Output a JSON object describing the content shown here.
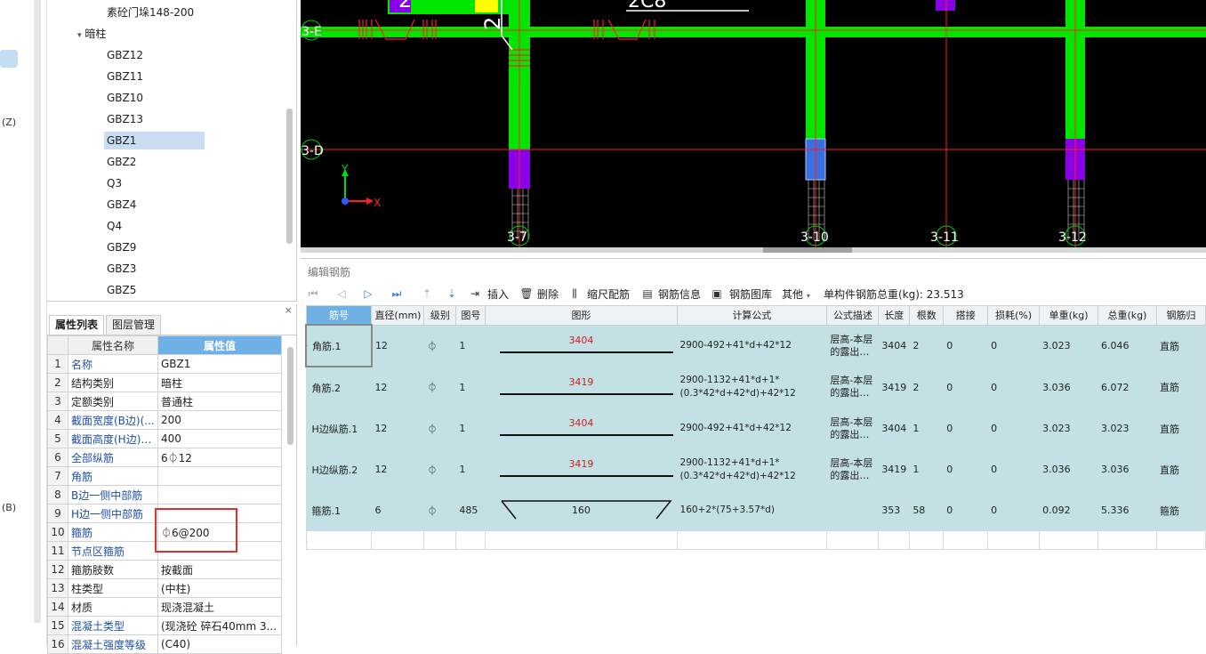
{
  "left_strip": {
    "label_z": "(Z)",
    "label_b": "(B)"
  },
  "tree": {
    "top_item": "素砼门垛148-200",
    "group": "暗柱",
    "items": [
      "GBZ12",
      "GBZ11",
      "GBZ10",
      "GBZ13",
      "GBZ1",
      "GBZ2",
      "Q3",
      "GBZ4",
      "Q4",
      "GBZ9",
      "GBZ3",
      "GBZ5"
    ],
    "selected": "GBZ1"
  },
  "props": {
    "tabs": [
      "属性列表",
      "图层管理"
    ],
    "close": "×",
    "header": {
      "name": "属性名称",
      "value": "属性值"
    },
    "rows": [
      {
        "n": "1",
        "k": "名称",
        "v": "GBZ1"
      },
      {
        "n": "2",
        "k": "结构类别",
        "v": "暗柱"
      },
      {
        "n": "3",
        "k": "定额类别",
        "v": "普通柱"
      },
      {
        "n": "4",
        "k": "截面宽度(B边)(...",
        "v": "200"
      },
      {
        "n": "5",
        "k": "截面高度(H边)(...",
        "v": "400"
      },
      {
        "n": "6",
        "k": "全部纵筋",
        "v": "6⏀12"
      },
      {
        "n": "7",
        "k": "角筋",
        "v": ""
      },
      {
        "n": "8",
        "k": "B边一侧中部筋",
        "v": ""
      },
      {
        "n": "9",
        "k": "H边一侧中部筋",
        "v": ""
      },
      {
        "n": "10",
        "k": "箍筋",
        "v": "⏀6@200"
      },
      {
        "n": "11",
        "k": "节点区箍筋",
        "v": ""
      },
      {
        "n": "12",
        "k": "箍筋肢数",
        "v": "按截面"
      },
      {
        "n": "13",
        "k": "柱类型",
        "v": "(中柱)"
      },
      {
        "n": "14",
        "k": "材质",
        "v": "现浇混凝土"
      },
      {
        "n": "15",
        "k": "混凝土类型",
        "v": "(现浇砼 碎石40mm 3..."
      },
      {
        "n": "16",
        "k": "混凝土强度等级",
        "v": "(C40)"
      }
    ]
  },
  "canvas": {
    "axis_y": "Y",
    "axis_x": "X",
    "labels": {
      "r1": "3-E",
      "r2": "3-D",
      "c1": "3-7",
      "c2": "3-10",
      "c3": "3-11",
      "c4": "3-12"
    },
    "colors": {
      "bg": "#000000",
      "wall": "#00e600",
      "column": "#8a00e6",
      "grid": "#ff0000",
      "blue_col": "#3a6fe0"
    }
  },
  "editor": {
    "title": "编辑钢筋",
    "toolbar": {
      "insert": "插入",
      "delete": "删除",
      "scale": "缩尺配筋",
      "info": "钢筋信息",
      "library": "钢筋图库",
      "other": "其他",
      "total": "单构件钢筋总重(kg): 23.513"
    },
    "columns": [
      "筋号",
      "直径(mm)",
      "级别",
      "图号",
      "图形",
      "计算公式",
      "公式描述",
      "长度",
      "根数",
      "搭接",
      "损耗(%)",
      "单重(kg)",
      "总重(kg)",
      "钢筋归"
    ],
    "rows": [
      {
        "idx": "1",
        "name": "角筋.1",
        "dia": "12",
        "grade": "⏀",
        "fig": "1",
        "shape": "3404",
        "formula": "2900-492+41*d+42*12",
        "desc": "层高-本层的露出…",
        "len": "3404",
        "count": "2",
        "lap": "0",
        "loss": "0",
        "unit": "3.023",
        "total": "6.046",
        "type": "直筋"
      },
      {
        "idx": "2",
        "name": "角筋.2",
        "dia": "12",
        "grade": "⏀",
        "fig": "1",
        "shape": "3419",
        "formula": "2900-1132+41*d+1*(0.3*42*d+42*d)+42*12",
        "desc": "层高-本层的露出…",
        "len": "3419",
        "count": "2",
        "lap": "0",
        "loss": "0",
        "unit": "3.036",
        "total": "6.072",
        "type": "直筋"
      },
      {
        "idx": "3",
        "name": "H边纵筋.1",
        "dia": "12",
        "grade": "⏀",
        "fig": "1",
        "shape": "3404",
        "formula": "2900-492+41*d+42*12",
        "desc": "层高-本层的露出…",
        "len": "3404",
        "count": "1",
        "lap": "0",
        "loss": "0",
        "unit": "3.023",
        "total": "3.023",
        "type": "直筋"
      },
      {
        "idx": "4",
        "name": "H边纵筋.2",
        "dia": "12",
        "grade": "⏀",
        "fig": "1",
        "shape": "3419",
        "formula": "2900-1132+41*d+1*(0.3*42*d+42*d)+42*12",
        "desc": "层高-本层的露出…",
        "len": "3419",
        "count": "1",
        "lap": "0",
        "loss": "0",
        "unit": "3.036",
        "total": "3.036",
        "type": "直筋"
      },
      {
        "idx": "5",
        "name": "箍筋.1",
        "dia": "6",
        "grade": "⏀",
        "fig": "485",
        "shape": "160",
        "formula": "160+2*(75+3.57*d)",
        "desc": "",
        "len": "353",
        "count": "58",
        "lap": "0",
        "loss": "0",
        "unit": "0.092",
        "total": "5.336",
        "type": "箍筋"
      }
    ],
    "blank_idx": "6"
  }
}
